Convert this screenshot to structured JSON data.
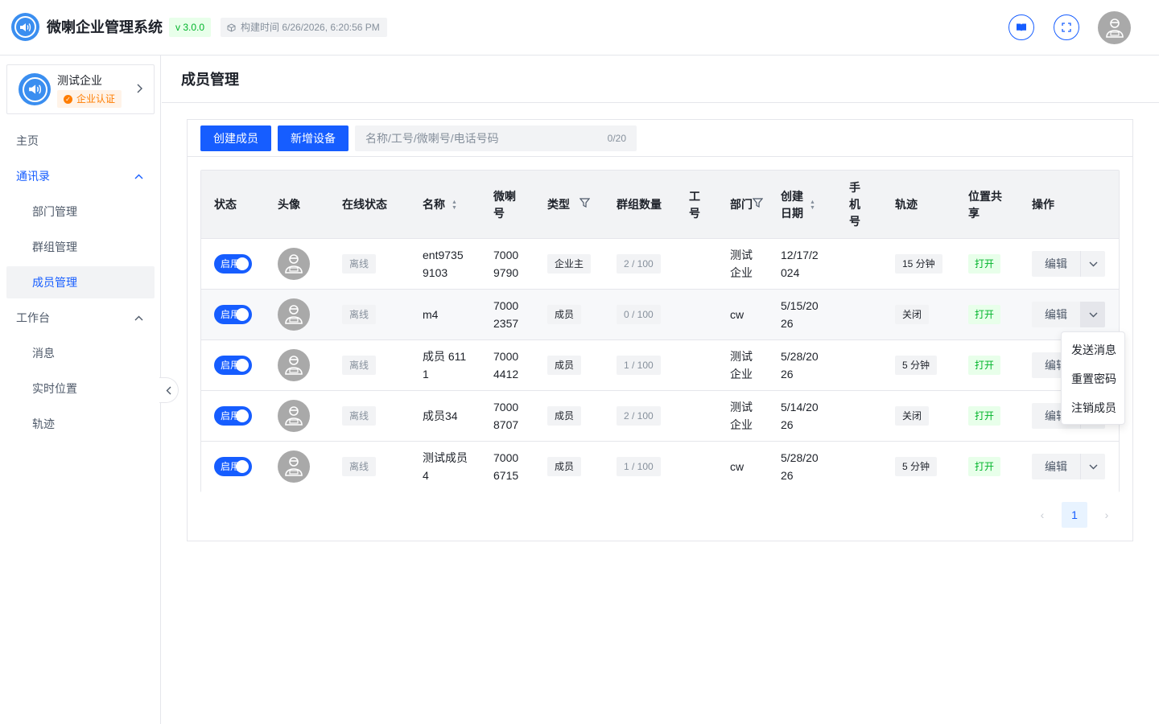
{
  "header": {
    "app_title": "微喇企业管理系统",
    "version": "v 3.0.0",
    "build_time": "构建时间 6/26/2026, 6:20:56 PM",
    "icons": [
      "book-icon",
      "fullscreen-icon"
    ]
  },
  "sidebar": {
    "enterprise_name": "测试企业",
    "enterprise_badge": "企业认证",
    "menu": {
      "home": "主页",
      "contacts": "通讯录",
      "dept": "部门管理",
      "group": "群组管理",
      "member": "成员管理",
      "workbench": "工作台",
      "message": "消息",
      "location": "实时位置",
      "track": "轨迹"
    }
  },
  "page": {
    "title": "成员管理"
  },
  "toolbar": {
    "create_member": "创建成员",
    "add_device": "新增设备",
    "search_placeholder": "名称/工号/微喇号/电话号码",
    "search_value": "",
    "search_count": "0/20"
  },
  "table": {
    "columns": {
      "status": "状态",
      "avatar": "头像",
      "online": "在线状态",
      "name": "名称",
      "weila_1": "微喇",
      "weila_2": "号",
      "type": "类型",
      "groups": "群组数量",
      "empno_1": "工",
      "empno_2": "号",
      "dept": "部门",
      "created_1": "创建",
      "created_2": "日期",
      "phone_1": "手",
      "phone_2": "机",
      "phone_3": "号",
      "track": "轨迹",
      "loc_1": "位置共",
      "loc_2": "享",
      "ops": "操作"
    },
    "rows": [
      {
        "status": "启用",
        "online": "离线",
        "name_1": "ent9735",
        "name_2": "9103",
        "weila_1": "7000",
        "weila_2": "9790",
        "type": "企业主",
        "groups": "2 / 100",
        "empno": "",
        "dept_1": "测试",
        "dept_2": "企业",
        "created_1": "12/17/2",
        "created_2": "024",
        "phone": "",
        "track": "15 分钟",
        "loc": "打开",
        "edit": "编辑"
      },
      {
        "status": "启用",
        "online": "离线",
        "name_1": "m4",
        "name_2": "",
        "weila_1": "7000",
        "weila_2": "2357",
        "type": "成员",
        "groups": "0 / 100",
        "empno": "",
        "dept_1": "cw",
        "dept_2": "",
        "created_1": "5/15/20",
        "created_2": "26",
        "phone": "",
        "track": "关闭",
        "loc": "打开",
        "edit": "编辑"
      },
      {
        "status": "启用",
        "online": "离线",
        "name_1": "成员 611",
        "name_2": "1",
        "weila_1": "7000",
        "weila_2": "4412",
        "type": "成员",
        "groups": "1 / 100",
        "empno": "",
        "dept_1": "测试",
        "dept_2": "企业",
        "created_1": "5/28/20",
        "created_2": "26",
        "phone": "",
        "track": "5 分钟",
        "loc": "打开",
        "edit": "编辑"
      },
      {
        "status": "启用",
        "online": "离线",
        "name_1": "成员34",
        "name_2": "",
        "weila_1": "7000",
        "weila_2": "8707",
        "type": "成员",
        "groups": "2 / 100",
        "empno": "",
        "dept_1": "测试",
        "dept_2": "企业",
        "created_1": "5/14/20",
        "created_2": "26",
        "phone": "",
        "track": "关闭",
        "loc": "打开",
        "edit": "编辑"
      },
      {
        "status": "启用",
        "online": "离线",
        "name_1": "测试成员",
        "name_2": "4",
        "weila_1": "7000",
        "weila_2": "6715",
        "type": "成员",
        "groups": "1 / 100",
        "empno": "",
        "dept_1": "cw",
        "dept_2": "",
        "created_1": "5/28/20",
        "created_2": "26",
        "phone": "",
        "track": "5 分钟",
        "loc": "打开",
        "edit": "编辑"
      }
    ]
  },
  "dropdown": {
    "items": [
      "发送消息",
      "重置密码",
      "注销成员"
    ]
  },
  "pagination": {
    "current": "1",
    "prev": "‹",
    "next": "›"
  },
  "colors": {
    "primary": "#165dff",
    "success": "#00b42a",
    "warning": "#ff7d00",
    "border": "#e5e6eb"
  }
}
